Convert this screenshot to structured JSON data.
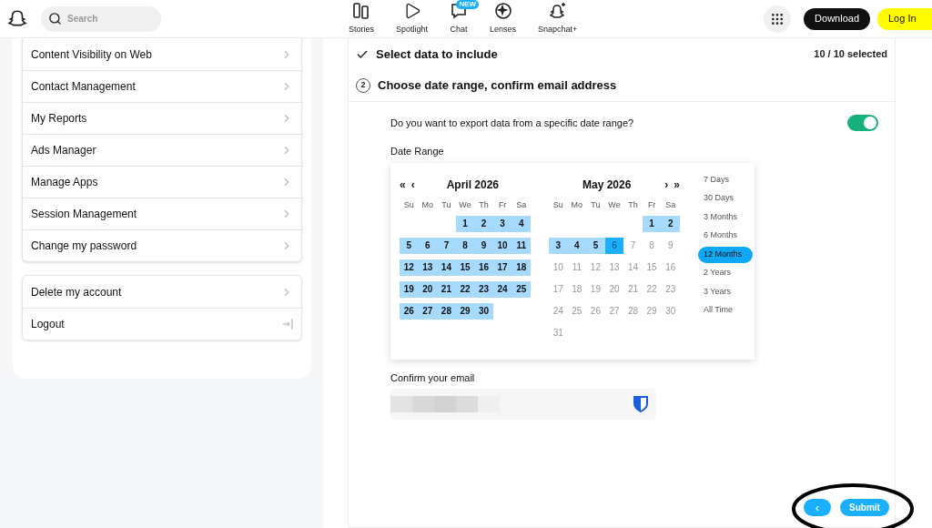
{
  "header": {
    "search": {
      "placeholder": "Search"
    },
    "nav": [
      {
        "label": "Stories"
      },
      {
        "label": "Spotlight"
      },
      {
        "label": "Chat",
        "badge": "NEW"
      },
      {
        "label": "Lenses"
      },
      {
        "label": "Snapchat+"
      }
    ],
    "download": "Download",
    "login": "Log In"
  },
  "sidebar": {
    "groups": [
      {
        "items": [
          {
            "label": "Content Visibility on Web",
            "kind": "chevron"
          },
          {
            "label": "Contact Management",
            "kind": "chevron"
          },
          {
            "label": "My Reports",
            "kind": "chevron"
          },
          {
            "label": "Ads Manager",
            "kind": "chevron"
          },
          {
            "label": "Manage Apps",
            "kind": "chevron"
          },
          {
            "label": "Session Management",
            "kind": "chevron"
          },
          {
            "label": "Change my password",
            "kind": "chevron"
          }
        ]
      },
      {
        "items": [
          {
            "label": "Delete my account",
            "kind": "chevron"
          },
          {
            "label": "Logout",
            "kind": "logout"
          }
        ]
      }
    ]
  },
  "steps": [
    {
      "title": "Select data to include",
      "done": true,
      "summary": "10 / 10 selected"
    },
    {
      "title": "Choose date range, confirm email address",
      "done": false,
      "number": "2"
    }
  ],
  "question": {
    "label": "Do you want to export data from a specific date range?",
    "on": true
  },
  "date_range": {
    "label": "Date Range",
    "months": [
      {
        "title": "April 2026",
        "nav": [
          "«",
          "‹"
        ],
        "weekdays": [
          "Su",
          "Mo",
          "Tu",
          "We",
          "Th",
          "Fr",
          "Sa"
        ],
        "weeks": [
          [
            {
              "kind": "blank"
            },
            {
              "kind": "blank"
            },
            {
              "kind": "blank"
            },
            {
              "label": "1",
              "kind": "range"
            },
            {
              "label": "2",
              "kind": "range"
            },
            {
              "label": "3",
              "kind": "range"
            },
            {
              "label": "4",
              "kind": "range"
            }
          ],
          [
            {
              "label": "5",
              "kind": "range"
            },
            {
              "label": "6",
              "kind": "range"
            },
            {
              "label": "7",
              "kind": "range"
            },
            {
              "label": "8",
              "kind": "range"
            },
            {
              "label": "9",
              "kind": "range"
            },
            {
              "label": "10",
              "kind": "range"
            },
            {
              "label": "11",
              "kind": "range"
            }
          ],
          [
            {
              "label": "12",
              "kind": "range"
            },
            {
              "label": "13",
              "kind": "range"
            },
            {
              "label": "14",
              "kind": "range"
            },
            {
              "label": "15",
              "kind": "range"
            },
            {
              "label": "16",
              "kind": "range"
            },
            {
              "label": "17",
              "kind": "range"
            },
            {
              "label": "18",
              "kind": "range"
            }
          ],
          [
            {
              "label": "19",
              "kind": "range"
            },
            {
              "label": "20",
              "kind": "range"
            },
            {
              "label": "21",
              "kind": "range"
            },
            {
              "label": "22",
              "kind": "range"
            },
            {
              "label": "23",
              "kind": "range"
            },
            {
              "label": "24",
              "kind": "range"
            },
            {
              "label": "25",
              "kind": "range"
            }
          ],
          [
            {
              "label": "26",
              "kind": "range"
            },
            {
              "label": "27",
              "kind": "range"
            },
            {
              "label": "28",
              "kind": "range"
            },
            {
              "label": "29",
              "kind": "range"
            },
            {
              "label": "30",
              "kind": "range"
            }
          ]
        ]
      },
      {
        "title": "May 2026",
        "nav": [
          "›",
          "»"
        ],
        "weekdays": [
          "Su",
          "Mo",
          "Tu",
          "We",
          "Th",
          "Fr",
          "Sa"
        ],
        "weeks": [
          [
            {
              "kind": "blank"
            },
            {
              "kind": "blank"
            },
            {
              "kind": "blank"
            },
            {
              "kind": "blank"
            },
            {
              "kind": "blank"
            },
            {
              "label": "1",
              "kind": "range"
            },
            {
              "label": "2",
              "kind": "range"
            }
          ],
          [
            {
              "label": "3",
              "kind": "range"
            },
            {
              "label": "4",
              "kind": "range"
            },
            {
              "label": "5",
              "kind": "range"
            },
            {
              "label": "6",
              "kind": "end"
            },
            {
              "label": "7",
              "kind": "disabled"
            },
            {
              "label": "8",
              "kind": "disabled"
            },
            {
              "label": "9",
              "kind": "disabled"
            }
          ],
          [
            {
              "label": "10",
              "kind": "disabled"
            },
            {
              "label": "11",
              "kind": "disabled"
            },
            {
              "label": "12",
              "kind": "disabled"
            },
            {
              "label": "13",
              "kind": "disabled"
            },
            {
              "label": "14",
              "kind": "disabled"
            },
            {
              "label": "15",
              "kind": "disabled"
            },
            {
              "label": "16",
              "kind": "disabled"
            }
          ],
          [
            {
              "label": "17",
              "kind": "disabled"
            },
            {
              "label": "18",
              "kind": "disabled"
            },
            {
              "label": "19",
              "kind": "disabled"
            },
            {
              "label": "20",
              "kind": "disabled"
            },
            {
              "label": "21",
              "kind": "disabled"
            },
            {
              "label": "22",
              "kind": "disabled"
            },
            {
              "label": "23",
              "kind": "disabled"
            }
          ],
          [
            {
              "label": "24",
              "kind": "disabled"
            },
            {
              "label": "25",
              "kind": "disabled"
            },
            {
              "label": "26",
              "kind": "disabled"
            },
            {
              "label": "27",
              "kind": "disabled"
            },
            {
              "label": "28",
              "kind": "disabled"
            },
            {
              "label": "29",
              "kind": "disabled"
            },
            {
              "label": "30",
              "kind": "disabled"
            }
          ],
          [
            {
              "label": "31",
              "kind": "disabled"
            }
          ]
        ]
      }
    ],
    "presets": [
      {
        "label": "7 Days",
        "selected": false
      },
      {
        "label": "30 Days",
        "selected": false
      },
      {
        "label": "3 Months",
        "selected": false
      },
      {
        "label": "6 Months",
        "selected": false
      },
      {
        "label": "12 Months",
        "selected": true
      },
      {
        "label": "2 Years",
        "selected": false
      },
      {
        "label": "3 Years",
        "selected": false
      },
      {
        "label": "All Time",
        "selected": false
      }
    ]
  },
  "email": {
    "label": "Confirm your email",
    "redacted": true
  },
  "actions": {
    "back": "‹",
    "submit": "Submit",
    "circled": true
  }
}
